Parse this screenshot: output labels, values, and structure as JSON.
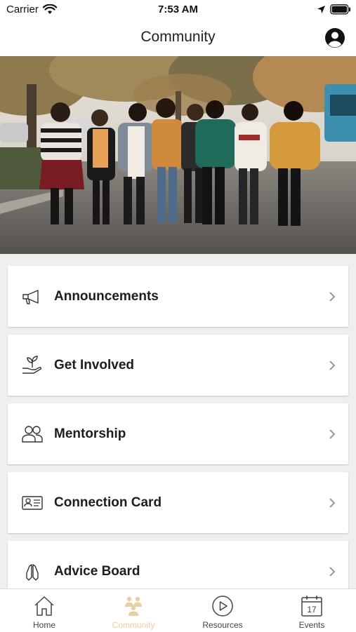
{
  "status_bar": {
    "carrier": "Carrier",
    "time": "7:53 AM"
  },
  "nav": {
    "title": "Community"
  },
  "menu": [
    {
      "label": "Announcements",
      "icon": "megaphone-icon"
    },
    {
      "label": "Get Involved",
      "icon": "hand-plant-icon"
    },
    {
      "label": "Mentorship",
      "icon": "people-icon"
    },
    {
      "label": "Connection Card",
      "icon": "id-card-icon"
    },
    {
      "label": "Advice Board",
      "icon": "praying-hands-icon"
    }
  ],
  "tabs": [
    {
      "label": "Home",
      "icon": "home-icon",
      "active": false
    },
    {
      "label": "Community",
      "icon": "community-icon",
      "active": true
    },
    {
      "label": "Resources",
      "icon": "play-circle-icon",
      "active": false
    },
    {
      "label": "Events",
      "icon": "calendar-icon",
      "active": false,
      "calendar_day": "17"
    }
  ],
  "colors": {
    "accent": "#e8cfa2",
    "background": "#efefef",
    "card": "#ffffff"
  }
}
